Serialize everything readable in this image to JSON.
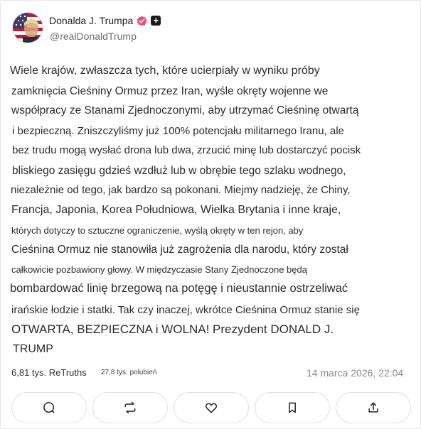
{
  "author": {
    "display_name": "Donalda J. Trumpa",
    "handle": "@realDonaldTrump",
    "verified_badge_color": "#e8507a"
  },
  "post": {
    "lines": [
      "Wiele krajów, zwłaszcza tych, które ucierpiały w wyniku próby",
      "zamknięcia Cieśniny Ormuz przez Iran, wyśle okręty wojenne we",
      "współpracy ze Stanami Zjednoczonymi, aby utrzymać Cieśninę otwartą",
      "i bezpieczną. Zniszczyliśmy już 100% potencjału militarnego Iranu, ale",
      "bez trudu mogą wysłać drona lub dwa, zrzucić minę lub dostarczyć pocisk",
      "bliskiego zasięgu gdzieś wzdłuż lub w obrębie tego szlaku wodnego,",
      "niezależnie od tego, jak bardzo są pokonani. Miejmy nadzieję, że Chiny,",
      "Francja, Japonia, Korea Południowa, Wielka Brytania i inne kraje,",
      "których dotyczy to sztuczne ograniczenie, wyślą okręty w ten rejon, aby",
      "Cieśnina Ormuz nie stanowiła już zagrożenia dla narodu, który został",
      "całkowicie pozbawiony głowy. W międzyczasie Stany Zjednoczone będą",
      "bombardować linię brzegową na potęgę i nieustannie ostrzeliwać",
      "irańskie łodzie i statki. Tak czy inaczej, wkrótce Cieśnina Ormuz stanie się",
      "OTWARTA, BEZPIECZNA i WOLNA! Prezydent DONALD J.",
      "TRUMP"
    ]
  },
  "stats": {
    "retruths": "6,81 tys. ReTruths",
    "likes": "27,8 tys. polubień",
    "date": "14 marca 2026, 22:04"
  },
  "actions": [
    {
      "icon": "reply-icon"
    },
    {
      "icon": "retruth-icon"
    },
    {
      "icon": "heart-icon"
    },
    {
      "icon": "bookmark-icon"
    },
    {
      "icon": "share-icon"
    }
  ]
}
